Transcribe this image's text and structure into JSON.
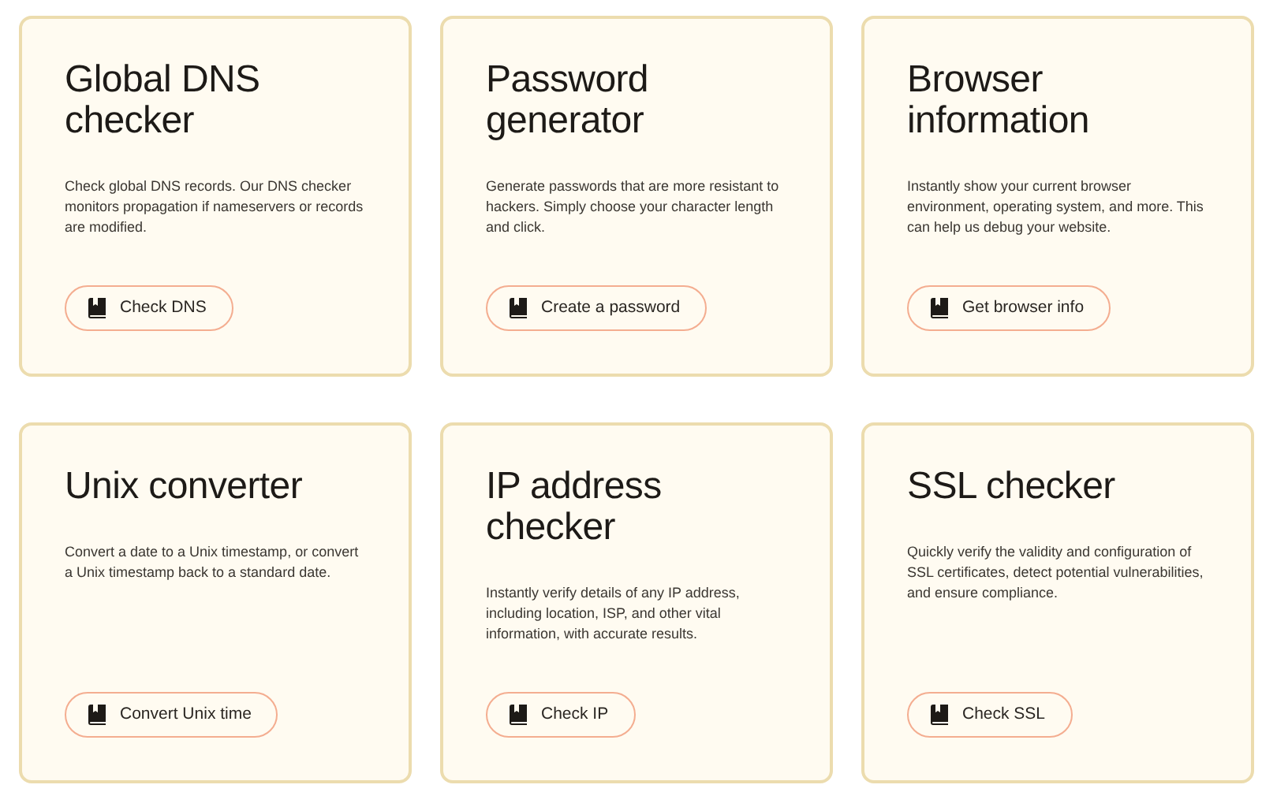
{
  "cards": [
    {
      "title": "Global DNS checker",
      "description": "Check global DNS records. Our DNS checker monitors propagation if nameservers or records are modified.",
      "button": "Check DNS"
    },
    {
      "title": "Password generator",
      "description": "Generate passwords that are more resistant to hackers. Simply choose your character length and click.",
      "button": "Create a password"
    },
    {
      "title": "Browser information",
      "description": "Instantly show your current browser environment, operating system, and more. This can help us debug your website.",
      "button": "Get browser info"
    },
    {
      "title": "Unix converter",
      "description": "Convert a date to a Unix timestamp, or convert a Unix timestamp back to a standard date.",
      "button": "Convert Unix time"
    },
    {
      "title": "IP address checker",
      "description": "Instantly verify details of any IP address, including location, ISP, and other vital information, with accurate results.",
      "button": "Check IP"
    },
    {
      "title": "SSL checker",
      "description": "Quickly verify the validity and configuration of SSL certificates, detect potential vulnerabilities, and ensure compliance.",
      "button": "Check SSL"
    }
  ]
}
